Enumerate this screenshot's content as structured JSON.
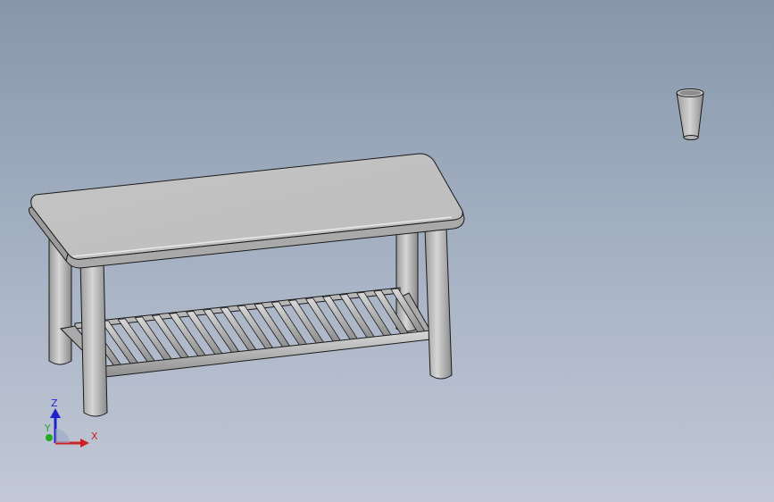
{
  "viewport": {
    "background_top": "#8796ab",
    "background_bottom": "#c2c8d6",
    "model_color": "#c0c0c0",
    "edge_color": "#1a1a1a"
  },
  "triad": {
    "z_label": "Z",
    "x_label": "X",
    "y_label": "Y",
    "z_color": "#2222cc",
    "x_color": "#cc2222",
    "y_color": "#22aa22"
  }
}
